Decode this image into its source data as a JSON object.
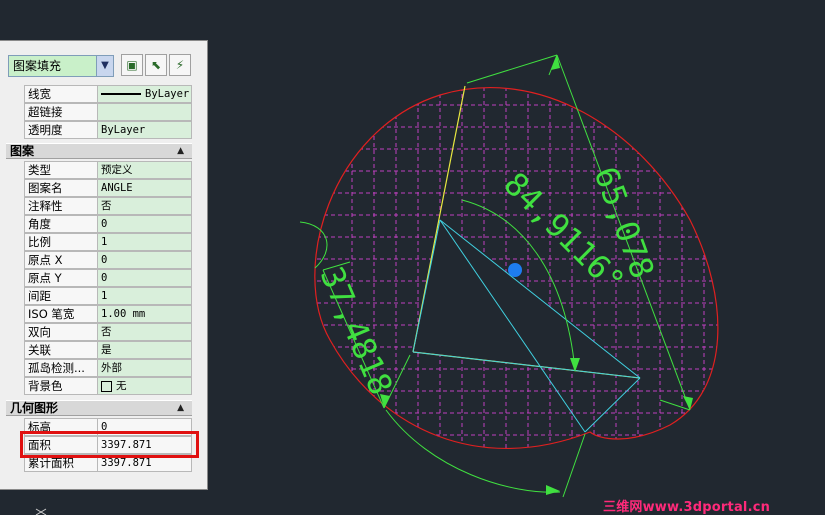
{
  "toolbar": {
    "object_type": "图案填充"
  },
  "props_top": [
    {
      "key": "线宽",
      "value": "ByLayer"
    },
    {
      "key": "超链接",
      "value": ""
    },
    {
      "key": "透明度",
      "value": "ByLayer"
    }
  ],
  "pattern": {
    "title": "图案",
    "rows": [
      {
        "key": "类型",
        "value": "预定义"
      },
      {
        "key": "图案名",
        "value": "ANGLE"
      },
      {
        "key": "注释性",
        "value": "否"
      },
      {
        "key": "角度",
        "value": "0"
      },
      {
        "key": "比例",
        "value": "1"
      },
      {
        "key": "原点 X",
        "value": "0"
      },
      {
        "key": "原点 Y",
        "value": "0"
      },
      {
        "key": "间距",
        "value": "1"
      },
      {
        "key": "ISO 笔宽",
        "value": "1.00 mm"
      },
      {
        "key": "双向",
        "value": "否"
      },
      {
        "key": "关联",
        "value": "是"
      },
      {
        "key": "孤岛检测...",
        "value": "外部"
      },
      {
        "key": "背景色",
        "value": "无"
      }
    ]
  },
  "geometry": {
    "title": "几何图形",
    "rows": [
      {
        "key": "标高",
        "value": "0"
      },
      {
        "key": "面积",
        "value": "3397.871"
      },
      {
        "key": "累计面积",
        "value": "3397.871"
      }
    ]
  },
  "drawing": {
    "dim_aligned_1": "65,078",
    "dim_angular": "84,9116°",
    "dim_aligned_2": "37,4818"
  },
  "watermark": "三维网www.3dportal.cn",
  "colors": {
    "background": "#212830",
    "ellipse": "#e02020",
    "hatch": "#c040c0",
    "dimension": "#40e040",
    "highlight": "#e01010"
  }
}
